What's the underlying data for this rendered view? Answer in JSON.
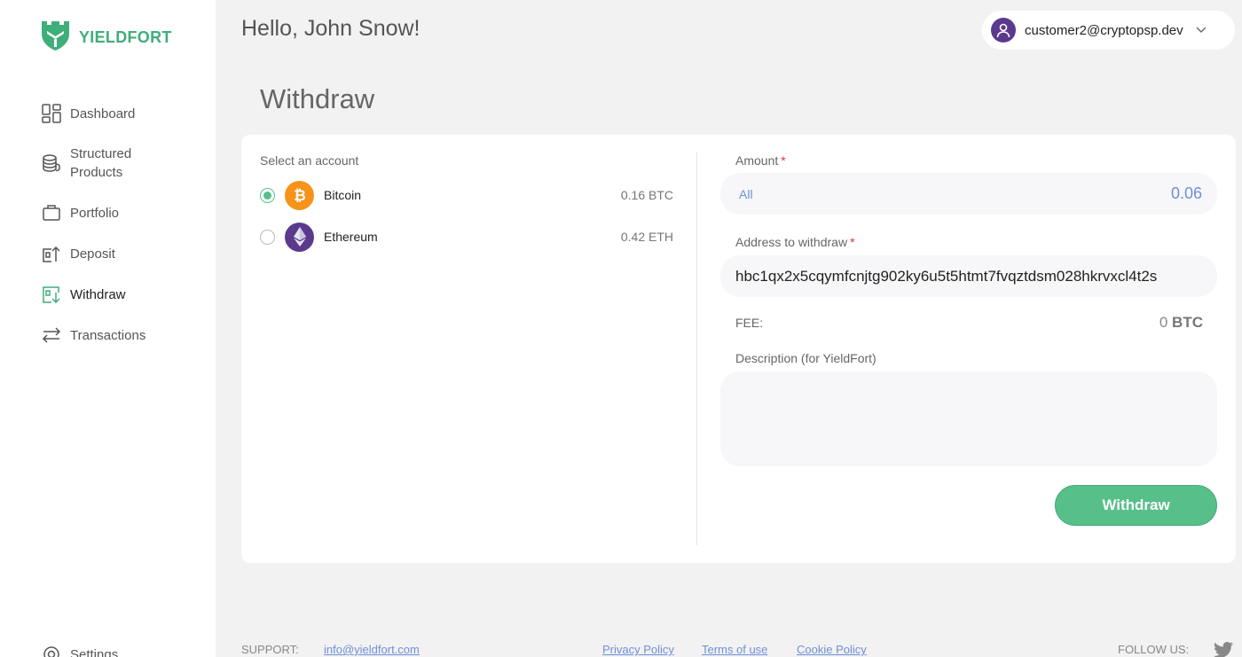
{
  "brand": {
    "name": "YIELDFORT",
    "color": "#3fae7a"
  },
  "header": {
    "greeting": "Hello, John Snow!",
    "user_email": "customer2@cryptopsp.dev"
  },
  "sidebar": {
    "items": [
      {
        "label": "Dashboard",
        "icon": "dashboard-icon"
      },
      {
        "label": "Structured Products",
        "label_line1": "Structured",
        "label_line2": "Products",
        "icon": "stack-icon"
      },
      {
        "label": "Portfolio",
        "icon": "briefcase-icon"
      },
      {
        "label": "Deposit",
        "icon": "deposit-icon"
      },
      {
        "label": "Withdraw",
        "icon": "withdraw-icon",
        "active": true
      },
      {
        "label": "Transactions",
        "icon": "transfer-arrows-icon"
      }
    ],
    "settings_label": "Settings"
  },
  "page": {
    "title": "Withdraw"
  },
  "accounts": {
    "label": "Select an account",
    "items": [
      {
        "name": "Bitcoin",
        "balance": "0.16 BTC",
        "selected": true,
        "icon": "bitcoin-icon"
      },
      {
        "name": "Ethereum",
        "balance": "0.42 ETH",
        "selected": false,
        "icon": "ethereum-icon"
      }
    ]
  },
  "form": {
    "amount_label": "Amount",
    "required_mark": "*",
    "amount_all": "All",
    "amount_value": "0.06",
    "address_label": "Address to withdraw",
    "address_value": "hbc1qx2x5cqymfcnjtg902ky6u5t5htmt7fvqztdsm028hkrvxcl4t2s",
    "fee_label": "FEE:",
    "fee_amount": "0",
    "fee_unit": "BTC",
    "description_label": "Description (for YieldFort)",
    "description_value": "",
    "submit_label": "Withdraw"
  },
  "footer": {
    "support_label": "SUPPORT:",
    "support_email": "info@yieldfort.com",
    "privacy": "Privacy Policy",
    "terms": "Terms of use",
    "cookie": "Cookie Policy",
    "follow_label": "FOLLOW US:"
  },
  "colors": {
    "accent_green": "#57bf8a",
    "link_blue": "#6f8fd6",
    "btc_orange": "#f7931a",
    "eth_purple": "#5b3a8e"
  }
}
